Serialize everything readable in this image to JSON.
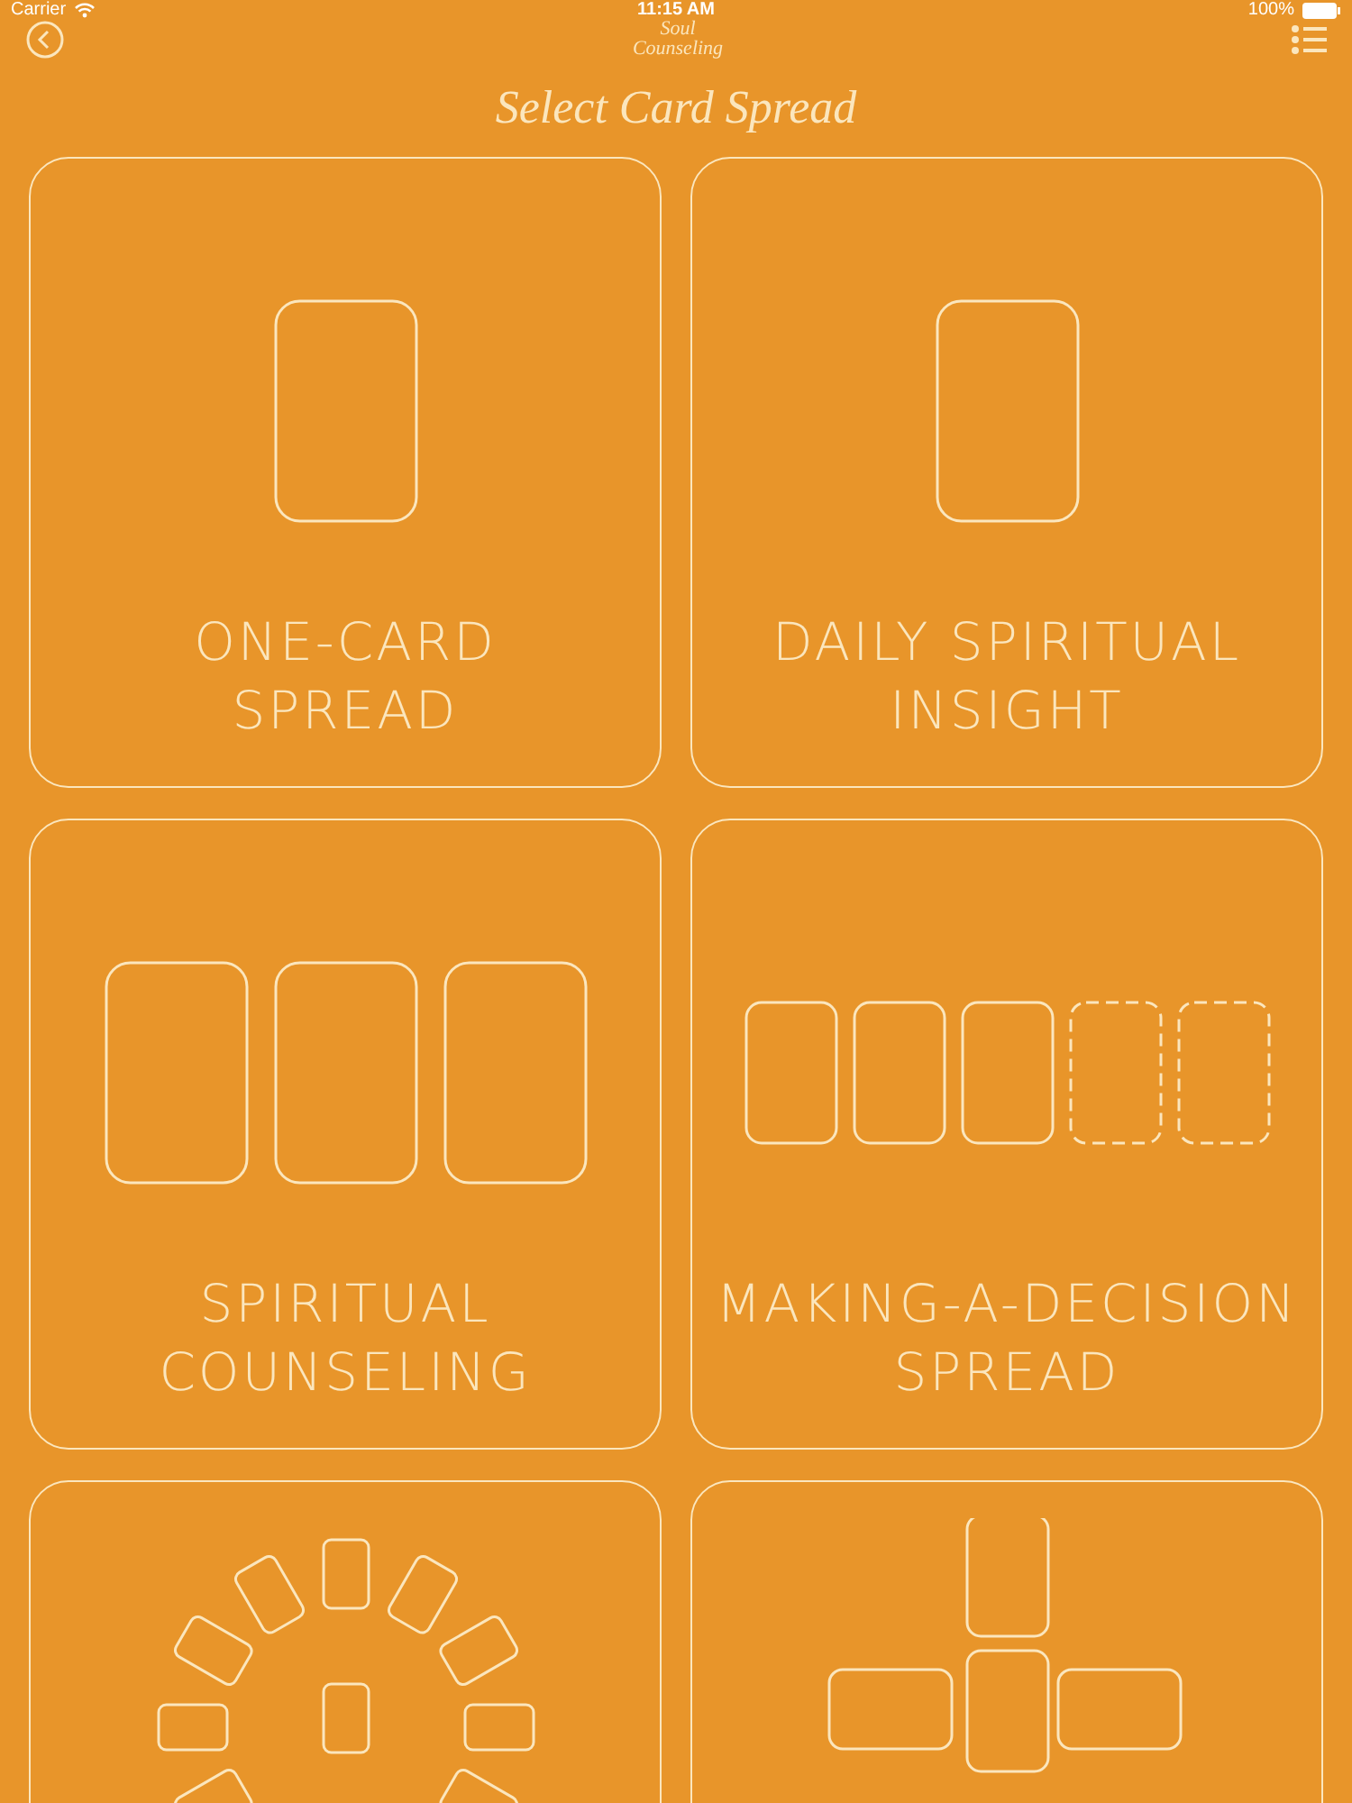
{
  "status_bar": {
    "carrier": "Carrier",
    "time": "11:15 AM",
    "battery": "100%"
  },
  "nav": {
    "logo_top": "Soul",
    "logo_bottom": "Counseling"
  },
  "title": "Select Card Spread",
  "cards": [
    {
      "label": "ONE-CARD\nSPREAD",
      "kind": "single"
    },
    {
      "label": "DAILY SPIRITUAL\nINSIGHT",
      "kind": "single"
    },
    {
      "label": "SPIRITUAL\nCOUNSELING",
      "kind": "row",
      "slots": [
        {
          "dashed": false
        },
        {
          "dashed": false
        },
        {
          "dashed": false
        }
      ]
    },
    {
      "label": "MAKING-A-DECISION\nSPREAD",
      "kind": "row",
      "slots": [
        {
          "dashed": false
        },
        {
          "dashed": false
        },
        {
          "dashed": false
        },
        {
          "dashed": true
        },
        {
          "dashed": true
        }
      ]
    },
    {
      "kind": "circle"
    },
    {
      "kind": "cross"
    }
  ]
}
